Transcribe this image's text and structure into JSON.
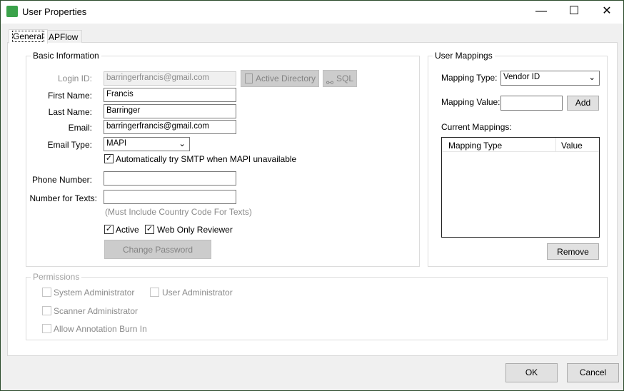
{
  "window": {
    "title": "User Properties",
    "minimize": "—",
    "maximize": "☐",
    "close": "✕"
  },
  "tabs": [
    {
      "label": "General"
    },
    {
      "label": "APFlow"
    }
  ],
  "basic": {
    "legend": "Basic Information",
    "login_label": "Login ID:",
    "login_value": "barringerfrancis@gmail.com",
    "ad_button": "Active Directory",
    "sql_button": "SQL",
    "first_label": "First Name:",
    "first_value": "Francis",
    "last_label": "Last Name:",
    "last_value": "Barringer",
    "email_label": "Email:",
    "email_value": "barringerfrancis@gmail.com",
    "email_type_label": "Email Type:",
    "email_type_value": "MAPI",
    "smtp_label": "Automatically try SMTP when MAPI unavailable",
    "phone_label": "Phone Number:",
    "phone_value": "",
    "texts_label": "Number for Texts:",
    "texts_value": "",
    "texts_hint": "(Must Include Country Code For Texts)",
    "active_label": "Active",
    "web_label": "Web Only Reviewer",
    "change_password": "Change Password"
  },
  "mappings": {
    "legend": "User Mappings",
    "type_label": "Mapping Type:",
    "type_value": "Vendor ID",
    "value_label": "Mapping Value:",
    "value_value": "",
    "add": "Add",
    "current_label": "Current Mappings:",
    "columns": [
      "Mapping Type",
      "Value"
    ],
    "remove": "Remove"
  },
  "permissions": {
    "legend": "Permissions",
    "items": [
      "System Administrator",
      "User Administrator",
      "Scanner Administrator",
      "Allow Annotation Burn In"
    ]
  },
  "footer": {
    "ok": "OK",
    "cancel": "Cancel"
  }
}
